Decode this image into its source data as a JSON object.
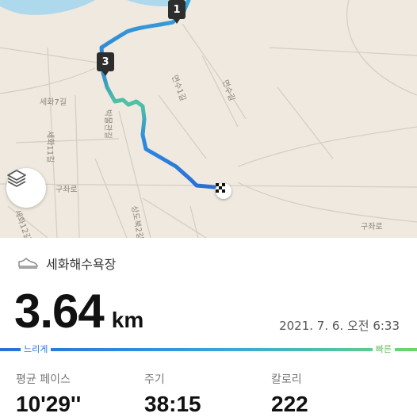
{
  "map": {
    "road_labels": [
      "세화7길",
      "세화11길",
      "박물관길",
      "면수1길",
      "면수길",
      "구좌로",
      "구좌로",
      "세화12길",
      "상도북2길"
    ],
    "markers": [
      "1",
      "3"
    ],
    "layers_icon": "layers-icon",
    "finish_icon": "checkered-flag-icon"
  },
  "activity": {
    "location": "세화해수욕장",
    "shoe_icon": "shoe-icon",
    "distance_value": "3.64",
    "distance_unit": "km",
    "datetime": "2021. 7. 6. 오전 6:33"
  },
  "pace_legend": {
    "slow_label": "느리게",
    "fast_label": "빠른",
    "slow_color": "#2b6fd6",
    "fast_color": "#6fd66a"
  },
  "stats": [
    {
      "label": "평균 페이스",
      "value": "10'29''"
    },
    {
      "label": "주기",
      "value": "38:15"
    },
    {
      "label": "칼로리",
      "value": "222"
    }
  ]
}
